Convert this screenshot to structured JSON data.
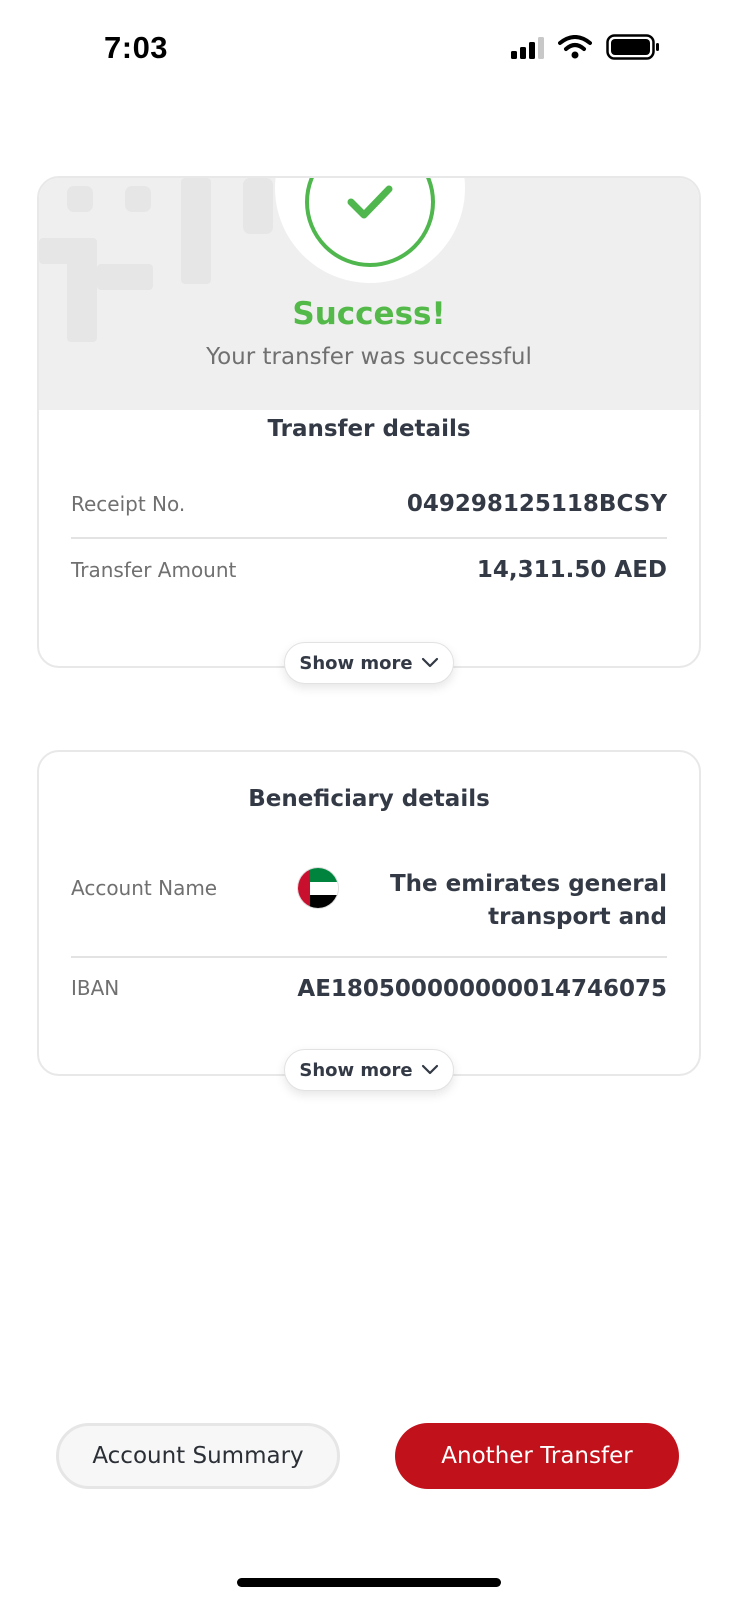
{
  "status_bar": {
    "time": "7:03"
  },
  "result": {
    "title": "Success!",
    "subtitle": "Your transfer was successful"
  },
  "transfer_details": {
    "title": "Transfer details",
    "rows": [
      {
        "label": "Receipt No.",
        "value": "049298125118BCSY"
      },
      {
        "label": "Transfer Amount",
        "value": "14,311.50 AED"
      }
    ],
    "show_more_label": "Show more"
  },
  "beneficiary_details": {
    "title": "Beneficiary details",
    "account_name": {
      "label": "Account Name",
      "value": "The emirates general transport and"
    },
    "iban": {
      "label": "IBAN",
      "value": "AE180500000000014746075"
    },
    "show_more_label": "Show more"
  },
  "actions": {
    "secondary_label": "Account Summary",
    "primary_label": "Another Transfer"
  },
  "colors": {
    "success_green": "#53b949",
    "primary_red": "#c1121c",
    "text_dark": "#333a45",
    "text_muted": "#707070"
  },
  "icons": [
    "signal-icon",
    "wifi-icon",
    "battery-icon",
    "checkmark-icon",
    "chevron-down-icon",
    "uae-flag-icon"
  ]
}
